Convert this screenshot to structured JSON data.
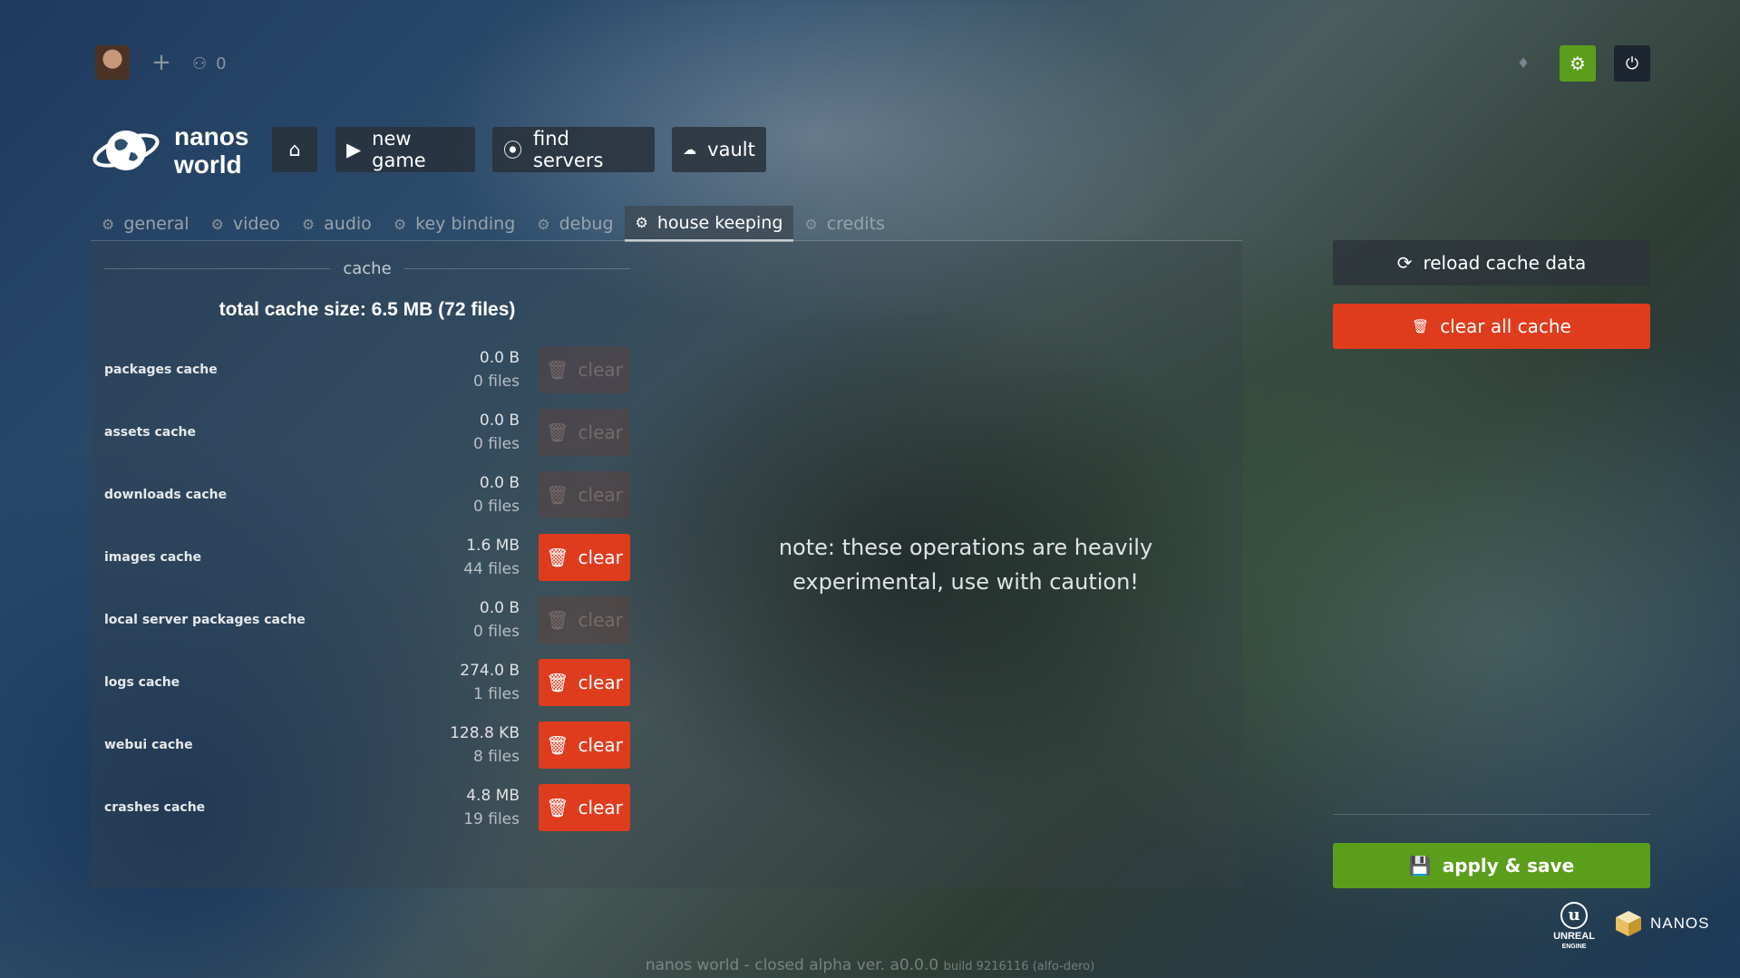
{
  "topbar": {
    "friends_count": "0"
  },
  "logo": {
    "line1": "nanos",
    "line2": "world"
  },
  "nav": {
    "new_game": "new game",
    "find_servers": "find servers",
    "vault": "vault"
  },
  "tabs": [
    {
      "label": "general"
    },
    {
      "label": "video"
    },
    {
      "label": "audio"
    },
    {
      "label": "key binding"
    },
    {
      "label": "debug"
    },
    {
      "label": "house keeping",
      "active": true
    },
    {
      "label": "credits"
    }
  ],
  "cache": {
    "section_title": "cache",
    "total": "total cache size: 6.5 MB (72 files)",
    "clear_label": "clear",
    "rows": [
      {
        "label": "packages cache",
        "size": "0.0 B",
        "files": "0 files",
        "enabled": false
      },
      {
        "label": "assets cache",
        "size": "0.0 B",
        "files": "0 files",
        "enabled": false
      },
      {
        "label": "downloads cache",
        "size": "0.0 B",
        "files": "0 files",
        "enabled": false
      },
      {
        "label": "images cache",
        "size": "1.6 MB",
        "files": "44 files",
        "enabled": true
      },
      {
        "label": "local server packages cache",
        "size": "0.0 B",
        "files": "0 files",
        "enabled": false
      },
      {
        "label": "logs cache",
        "size": "274.0 B",
        "files": "1 files",
        "enabled": true
      },
      {
        "label": "webui cache",
        "size": "128.8 KB",
        "files": "8 files",
        "enabled": true
      },
      {
        "label": "crashes cache",
        "size": "4.8 MB",
        "files": "19 files",
        "enabled": true
      }
    ]
  },
  "note": "note: these operations are heavily experimental, use with caution!",
  "actions": {
    "reload": "reload cache data",
    "clear_all": "clear all cache",
    "apply_save": "apply & save"
  },
  "branding": {
    "unreal_line1": "UNREAL",
    "unreal_line2": "ENGINE",
    "nanos": "NANOS"
  },
  "footer": {
    "main": "nanos world - closed alpha  ver. a0.0.0",
    "build": "build 9216116  (alfo-dero)"
  },
  "colors": {
    "accent_green": "#5a9e1c",
    "danger_red": "#df3c1e"
  }
}
